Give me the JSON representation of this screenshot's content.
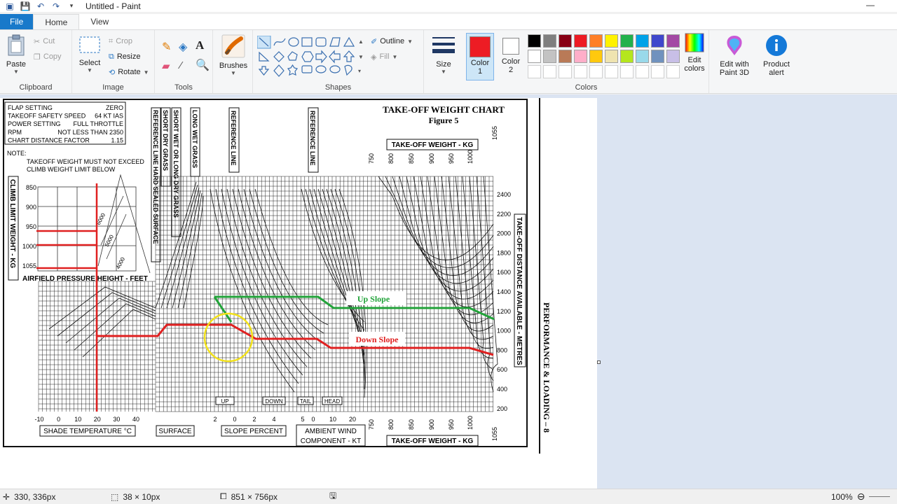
{
  "window": {
    "title": "Untitled - Paint",
    "minimize": "—"
  },
  "tabs": [
    {
      "label": "File"
    },
    {
      "label": "Home"
    },
    {
      "label": "View"
    }
  ],
  "groups": {
    "clipboard": {
      "label": "Clipboard",
      "paste": "Paste",
      "cut": "Cut",
      "copy": "Copy"
    },
    "image": {
      "label": "Image",
      "select": "Select",
      "crop": "Crop",
      "resize": "Resize",
      "rotate": "Rotate"
    },
    "tools": {
      "label": "Tools"
    },
    "brushes": {
      "label": "Brushes"
    },
    "shapes": {
      "label": "Shapes",
      "outline": "Outline",
      "fill": "Fill"
    },
    "size": {
      "label": "Size"
    },
    "colors": {
      "label": "Colors",
      "color1": "Color 1",
      "color2": "Color 2",
      "edit": "Edit colors",
      "color1_value": "#ed1c24",
      "color2_value": "#ffffff",
      "palette_row1": [
        "#000000",
        "#7f7f7f",
        "#880015",
        "#ed1c24",
        "#ff7f27",
        "#fff200",
        "#22b14c",
        "#00a2e8",
        "#3f48cc",
        "#a349a4"
      ],
      "palette_row2": [
        "#ffffff",
        "#c3c3c3",
        "#b97a57",
        "#ffaec9",
        "#ffc90e",
        "#efe4b0",
        "#b5e61d",
        "#99d9ea",
        "#7092be",
        "#c8bfe7"
      ]
    },
    "paint3d": {
      "label": "Edit with Paint 3D"
    },
    "alert": {
      "label": "Product alert"
    }
  },
  "chart": {
    "title": "TAKE-OFF WEIGHT CHART",
    "figure": "Figure 5",
    "conditions": [
      {
        "k": "FLAP SETTING",
        "v": "ZERO"
      },
      {
        "k": "TAKEOFF SAFETY SPEED",
        "v": "64 KT IAS"
      },
      {
        "k": "POWER SETTING",
        "v": "FULL THROTTLE"
      },
      {
        "k": "RPM",
        "v": "NOT LESS THAN 2350"
      },
      {
        "k": "CHART DISTANCE FACTOR",
        "v": "1.15"
      }
    ],
    "note_title": "NOTE:",
    "note_line1": "TAKEOFF WEIGHT MUST NOT EXCEED",
    "note_line2": "CLIMB WEIGHT LIMIT BELOW",
    "climb_label": "CLIMB LIMIT WEIGHT - KG",
    "climb_ticks": [
      "850",
      "900",
      "950",
      "1000",
      "1055"
    ],
    "pressure_label": "AIRFIELD PRESSURE HEIGHT - FEET",
    "pressure_ticks": [
      "6000",
      "5000",
      "4000"
    ],
    "surface_labels": [
      "REFERENCE LINE HARD SEALED SURFACE",
      "SHORT DRY GRASS",
      "SHORT WET OR LONG DRY GRASS",
      "LONG WET GRASS"
    ],
    "ref_line_1": "REFERENCE LINE",
    "ref_line_2": "REFERENCE LINE",
    "tow_label": "TAKE-OFF WEIGHT - KG",
    "tow_ticks": [
      "750",
      "800",
      "850",
      "900",
      "950",
      "1000",
      "1055"
    ],
    "dist_label": "TAKE-OFF DISTANCE AVAILABLE - METRES",
    "dist_ticks": [
      "2400",
      "2200",
      "2000",
      "1800",
      "1600",
      "1400",
      "1200",
      "1000",
      "800",
      "600",
      "400",
      "200"
    ],
    "shade_ticks": [
      "-10",
      "0",
      "10",
      "20",
      "30",
      "40"
    ],
    "slope_ticks": [
      "2",
      "0",
      "2",
      "4"
    ],
    "wind_ticks": [
      "5",
      "0",
      "10",
      "20"
    ],
    "up_box": "UP",
    "down_box": "DOWN",
    "tail_box": "TAIL",
    "head_box": "HEAD",
    "shade_label": "SHADE TEMPERATURE °C",
    "surface_label": "SURFACE",
    "slope_label": "SLOPE PERCENT",
    "wind_label_1": "AMBIENT WIND",
    "wind_label_2": "COMPONENT - KT",
    "up_slope": "Up Slope",
    "down_slope": "Down Slope",
    "side_title": "PERFORMANCE & LOADING – 8"
  },
  "status": {
    "cursor": "330, 336px",
    "selection": "38 × 10px",
    "canvas_size": "851 × 756px",
    "zoom": "100%"
  }
}
